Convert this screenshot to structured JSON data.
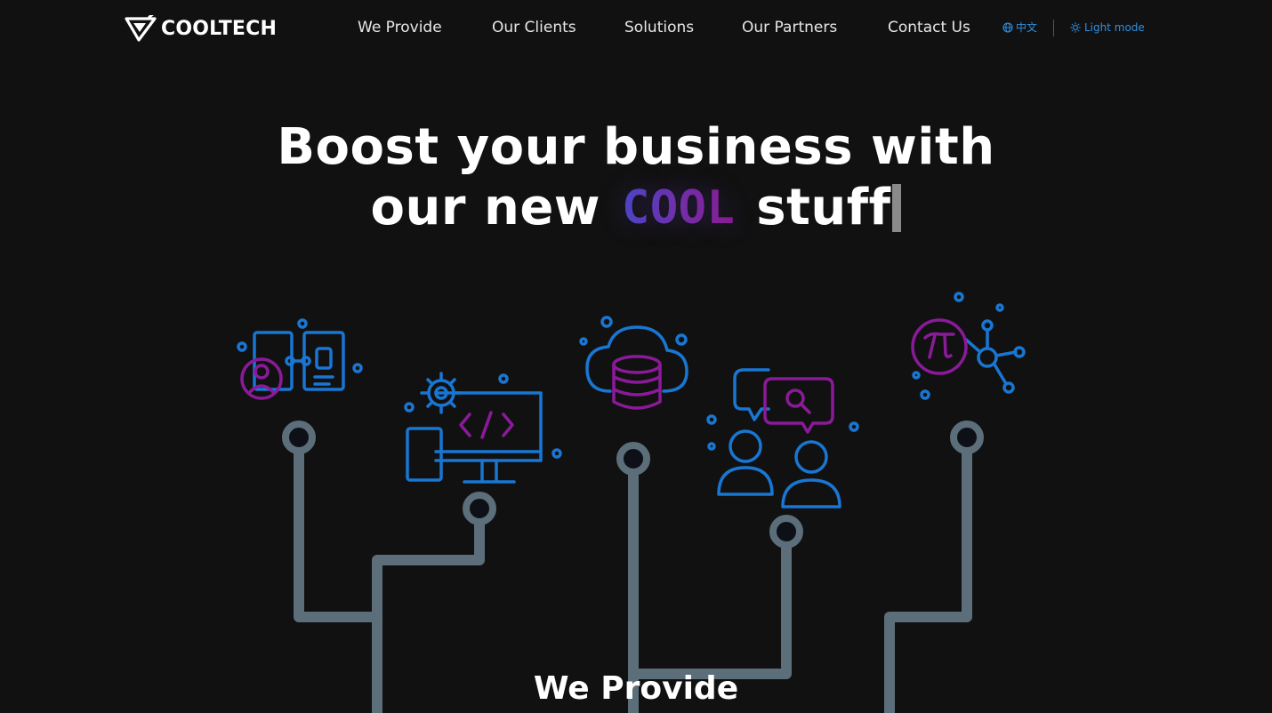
{
  "header": {
    "logo_text": "COOLTECH",
    "nav": [
      {
        "label": "We Provide"
      },
      {
        "label": "Our Clients"
      },
      {
        "label": "Solutions"
      },
      {
        "label": "Our Partners"
      },
      {
        "label": "Contact Us"
      }
    ],
    "language_label": "中文",
    "mode_label": "Light mode"
  },
  "hero": {
    "line1": "Boost your business with",
    "line2_prefix": "our new",
    "highlight": "COOL",
    "line2_suffix": "stuff"
  },
  "illustration": {
    "icons": [
      "mobile-profile-icon",
      "web-development-icon",
      "cloud-database-icon",
      "chat-search-users-icon",
      "pi-network-icon"
    ],
    "colors": {
      "blue": "#1976d2",
      "purple": "#8b1a9a",
      "circuit": "#5b6e7a"
    }
  },
  "section": {
    "title": "We Provide"
  }
}
